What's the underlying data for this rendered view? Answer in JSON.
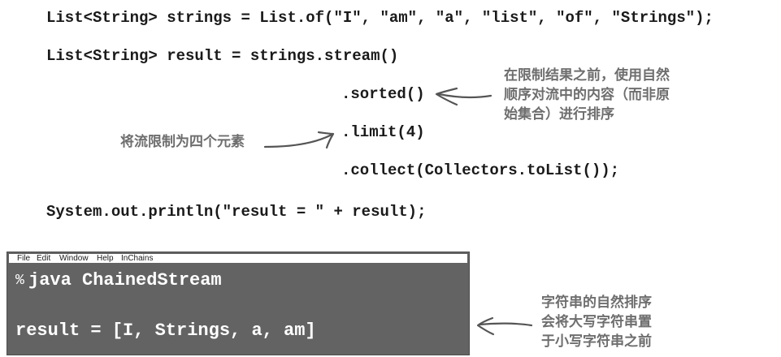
{
  "code": {
    "line1": "List<String> strings = List.of(\"I\", \"am\", \"a\", \"list\", \"of\", \"Strings\");",
    "line2": "List<String> result = strings.stream()",
    "line3": ".sorted()",
    "line4": ".limit(4)",
    "line5": ".collect(Collectors.toList());",
    "line6": "System.out.println(\"result = \" + result);"
  },
  "annotations": {
    "sorted_note": [
      "在限制结果之前，使用自然",
      "顺序对流中的内容（而非原",
      "始集合）进行排序"
    ],
    "limit_note": "将流限制为四个元素",
    "result_note": [
      "字符串的自然排序",
      "会将大写字符串置",
      "于小写字符串之前"
    ]
  },
  "terminal": {
    "menu": [
      "File",
      "Edit",
      "Window",
      "Help",
      "InChains"
    ],
    "prompt_symbol": "%",
    "command": "java ChainedStream",
    "output": "result = [I, Strings, a, am]"
  },
  "colors": {
    "code_text": "#1a1a1a",
    "annotation_text": "#6e6e6e",
    "terminal_bg": "#636363",
    "terminal_text": "#ffffff"
  }
}
